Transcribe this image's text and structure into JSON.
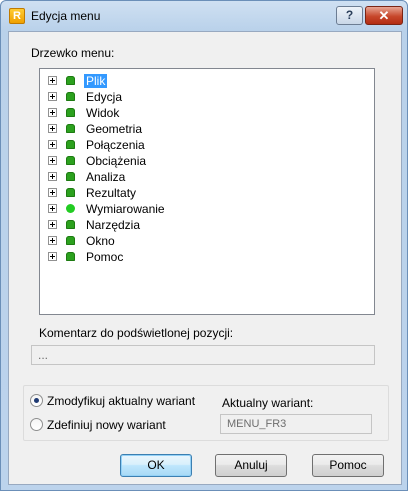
{
  "window": {
    "title": "Edycja menu",
    "app_icon_letter": "R"
  },
  "titlebar": {
    "help_label": "?",
    "close_label": "✕"
  },
  "tree": {
    "label": "Drzewko menu:",
    "items": [
      {
        "label": "Plik",
        "icon": "pin-icon",
        "selected": true
      },
      {
        "label": "Edycja",
        "icon": "pin-icon"
      },
      {
        "label": "Widok",
        "icon": "pin-icon"
      },
      {
        "label": "Geometria",
        "icon": "pin-icon"
      },
      {
        "label": "Połączenia",
        "icon": "pin-icon"
      },
      {
        "label": "Obciążenia",
        "icon": "pin-icon"
      },
      {
        "label": "Analiza",
        "icon": "pin-icon"
      },
      {
        "label": "Rezultaty",
        "icon": "pin-icon"
      },
      {
        "label": "Wymiarowanie",
        "icon": "circle-icon"
      },
      {
        "label": "Narzędzia",
        "icon": "pin-icon"
      },
      {
        "label": "Okno",
        "icon": "pin-icon"
      },
      {
        "label": "Pomoc",
        "icon": "pin-icon"
      }
    ]
  },
  "comment": {
    "label": "Komentarz do podświetlonej pozycji:",
    "value": "..."
  },
  "variant": {
    "option_modify": "Zmodyfikuj aktualny wariant",
    "option_new": "Zdefiniuj nowy wariant",
    "selected": "modify",
    "current_label": "Aktualny wariant:",
    "current_value": "MENU_FR3"
  },
  "buttons": {
    "ok": "OK",
    "cancel": "Anuluj",
    "help": "Pomoc"
  },
  "colors": {
    "selection": "#3399ff",
    "node_icon": "#2ca11e",
    "close_button": "#c7472b"
  }
}
